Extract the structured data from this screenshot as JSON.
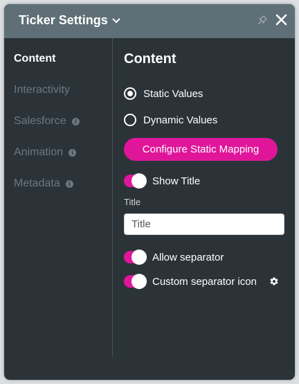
{
  "header": {
    "title": "Ticker Settings"
  },
  "sidebar": {
    "items": [
      {
        "label": "Content",
        "active": true,
        "info": false
      },
      {
        "label": "Interactivity",
        "active": false,
        "info": false
      },
      {
        "label": "Salesforce",
        "active": false,
        "info": true
      },
      {
        "label": "Animation",
        "active": false,
        "info": true
      },
      {
        "label": "Metadata",
        "active": false,
        "info": true
      }
    ],
    "info_glyph": "i"
  },
  "content": {
    "title": "Content",
    "radio_static": {
      "label": "Static Values",
      "checked": true
    },
    "radio_dynamic": {
      "label": "Dynamic Values",
      "checked": false
    },
    "configure_button": "Configure Static Mapping",
    "show_title": {
      "label": "Show Title",
      "on": true
    },
    "title_field": {
      "label": "Title",
      "placeholder": "Title",
      "value": ""
    },
    "allow_separator": {
      "label": "Allow separator",
      "on": true
    },
    "custom_separator": {
      "label": "Custom separator icon",
      "on": true
    }
  },
  "colors": {
    "accent": "#e0169a",
    "header_bg": "#5f6f78",
    "panel_bg": "#2b3338"
  }
}
